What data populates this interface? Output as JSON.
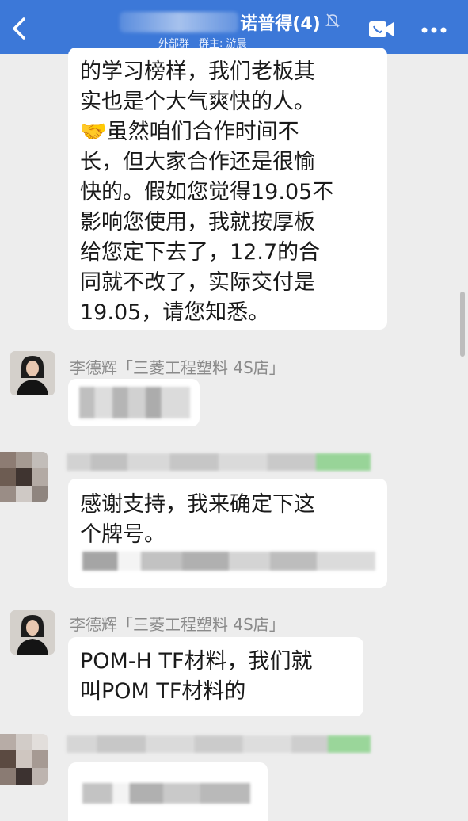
{
  "header": {
    "title": "诺普得(4)",
    "tag_external": "外部群",
    "group_owner": "群主: 游晨",
    "icons": [
      "chevron-left-icon",
      "mute-bell-icon",
      "video-call-icon",
      "more-dots-icon"
    ]
  },
  "messages": [
    {
      "text_lines": [
        "的学习榜样，我们老板其",
        "实也是个大气爽快的人。",
        "🤝虽然咱们合作时间不",
        "长，但大家合作还是很愉",
        "快的。假如您觉得19.05不",
        "影响您使用，我就按厚板",
        "给您定下去了，12.7的合",
        "同就不改了，实际交付是",
        "19.05，请您知悉。"
      ]
    },
    {
      "sender": "李德辉「三菱工程塑料 4S店」"
    },
    {
      "text_lines": [
        "感谢支持，我来确定下这",
        "个牌号。"
      ]
    },
    {
      "sender": "李德辉「三菱工程塑料 4S店」",
      "text_lines": [
        "POM-H TF材料，我们就",
        "叫POM TF材料的"
      ]
    }
  ],
  "colors": {
    "header_bg": "#3c78d8",
    "chat_bg": "#ededed",
    "bubble_bg": "#ffffff",
    "sender_name": "#8a8a8a"
  }
}
